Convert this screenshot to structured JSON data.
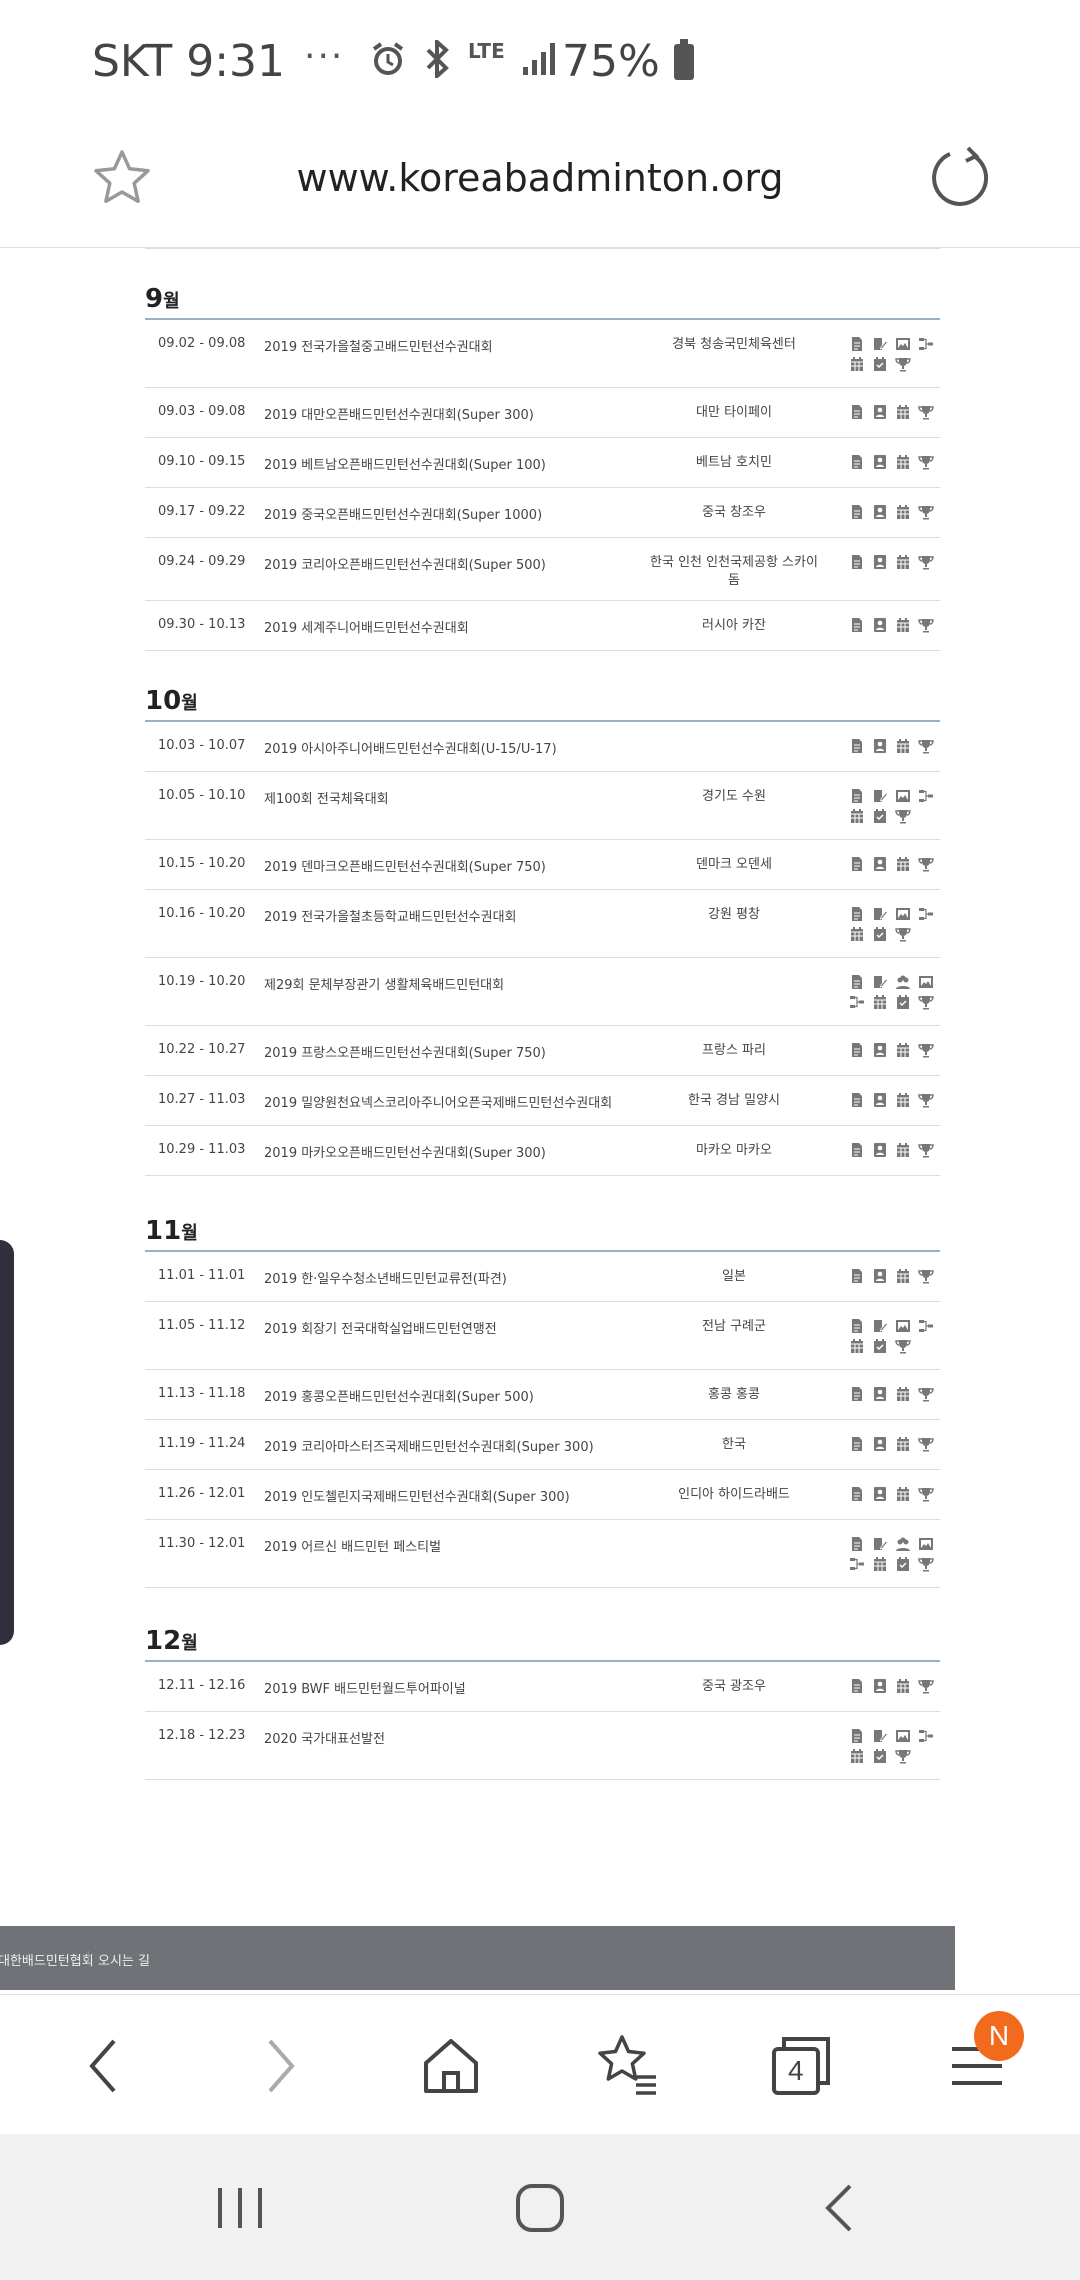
{
  "status_bar": {
    "carrier_time": "SKT 9:31",
    "dots": "···",
    "network": "LTE",
    "battery": "75%"
  },
  "url_bar": {
    "url": "www.koreabadminton.org"
  },
  "months": [
    {
      "label": "9",
      "suffix": "월",
      "rows": [
        {
          "date": "09.02 - 09.08",
          "name": "2019 전국가을철중고배드민턴선수권대회",
          "place": "경북 청송국민체육센터",
          "icons": [
            "doc",
            "edit",
            "photo",
            "bracket",
            "cal",
            "check",
            "trophy"
          ]
        },
        {
          "date": "09.03 - 09.08",
          "name": "2019 대만오픈배드민턴선수권대회(Super 300)",
          "place": "대만 타이페이",
          "icons": [
            "doc",
            "person",
            "cal",
            "trophy"
          ]
        },
        {
          "date": "09.10 - 09.15",
          "name": "2019 베트남오픈배드민턴선수권대회(Super 100)",
          "place": "베트남 호치민",
          "icons": [
            "doc",
            "person",
            "cal",
            "trophy"
          ]
        },
        {
          "date": "09.17 - 09.22",
          "name": "2019 중국오픈배드민턴선수권대회(Super 1000)",
          "place": "중국 창조우",
          "icons": [
            "doc",
            "person",
            "cal",
            "trophy"
          ]
        },
        {
          "date": "09.24 - 09.29",
          "name": "2019 코리아오픈배드민턴선수권대회(Super 500)",
          "place": "한국 인천 인천국제공항 스카이돔",
          "icons": [
            "doc",
            "person",
            "cal",
            "trophy"
          ]
        },
        {
          "date": "09.30 - 10.13",
          "name": "2019 세계주니어배드민턴선수권대회",
          "place": "러시아 카잔",
          "icons": [
            "doc",
            "person",
            "cal",
            "trophy"
          ]
        }
      ]
    },
    {
      "label": "10",
      "suffix": "월",
      "rows": [
        {
          "date": "10.03 - 10.07",
          "name": "2019 아시아주니어배드민턴선수권대회(U-15/U-17)",
          "place": "",
          "icons": [
            "doc",
            "person",
            "cal",
            "trophy"
          ]
        },
        {
          "date": "10.05 - 10.10",
          "name": "제100회 전국체육대회",
          "place": "경기도 수원",
          "icons": [
            "doc",
            "edit",
            "photo",
            "bracket",
            "cal",
            "check",
            "trophy"
          ]
        },
        {
          "date": "10.15 - 10.20",
          "name": "2019 덴마크오픈배드민턴선수권대회(Super 750)",
          "place": "덴마크 오덴세",
          "icons": [
            "doc",
            "person",
            "cal",
            "trophy"
          ]
        },
        {
          "date": "10.16 - 10.20",
          "name": "2019 전국가을철초등학교배드민턴선수권대회",
          "place": "강원 평창",
          "icons": [
            "doc",
            "edit",
            "photo",
            "bracket",
            "cal",
            "check",
            "trophy"
          ]
        },
        {
          "date": "10.19 - 10.20",
          "name": "제29회 문체부장관기 생활체육배드민턴대회",
          "place": "",
          "icons": [
            "doc",
            "edit",
            "group",
            "photo",
            "bracket",
            "cal",
            "check",
            "trophy"
          ]
        },
        {
          "date": "10.22 - 10.27",
          "name": "2019 프랑스오픈배드민턴선수권대회(Super 750)",
          "place": "프랑스 파리",
          "icons": [
            "doc",
            "person",
            "cal",
            "trophy"
          ]
        },
        {
          "date": "10.27 - 11.03",
          "name": "2019 밀양원천요넥스코리아주니어오픈국제배드민턴선수권대회",
          "place": "한국 경남 밀양시",
          "icons": [
            "doc",
            "person",
            "cal",
            "trophy"
          ]
        },
        {
          "date": "10.29 - 11.03",
          "name": "2019 마카오오픈배드민턴선수권대회(Super 300)",
          "place": "마카오 마카오",
          "icons": [
            "doc",
            "person",
            "cal",
            "trophy"
          ]
        }
      ]
    },
    {
      "label": "11",
      "suffix": "월",
      "rows": [
        {
          "date": "11.01 - 11.01",
          "name": "2019 한·일우수청소년배드민턴교류전(파견)",
          "place": "일본",
          "icons": [
            "doc",
            "person",
            "cal",
            "trophy"
          ]
        },
        {
          "date": "11.05 - 11.12",
          "name": "2019 회장기 전국대학실업배드민턴연맹전",
          "place": "전남 구례군",
          "icons": [
            "doc",
            "edit",
            "photo",
            "bracket",
            "cal",
            "check",
            "trophy"
          ]
        },
        {
          "date": "11.13 - 11.18",
          "name": "2019 홍콩오픈배드민턴선수권대회(Super 500)",
          "place": "홍콩 홍콩",
          "icons": [
            "doc",
            "person",
            "cal",
            "trophy"
          ]
        },
        {
          "date": "11.19 - 11.24",
          "name": "2019 코리아마스터즈국제배드민턴선수권대회(Super 300)",
          "place": "한국",
          "icons": [
            "doc",
            "person",
            "cal",
            "trophy"
          ]
        },
        {
          "date": "11.26 - 12.01",
          "name": "2019 인도첼린지국제배드민턴선수권대회(Super 300)",
          "place": "인디아 하이드라배드",
          "icons": [
            "doc",
            "person",
            "cal",
            "trophy"
          ]
        },
        {
          "date": "11.30 - 12.01",
          "name": "2019 어르신 배드민턴 페스티벌",
          "place": "",
          "icons": [
            "doc",
            "edit",
            "group",
            "photo",
            "bracket",
            "cal",
            "check",
            "trophy"
          ]
        }
      ]
    },
    {
      "label": "12",
      "suffix": "월",
      "rows": [
        {
          "date": "12.11 - 12.16",
          "name": "2019 BWF 배드민턴월드투어파이널",
          "place": "중국 광조우",
          "icons": [
            "doc",
            "person",
            "cal",
            "trophy"
          ]
        },
        {
          "date": "12.18 - 12.23",
          "name": "2020 국가대표선발전",
          "place": "",
          "icons": [
            "doc",
            "edit",
            "photo",
            "bracket",
            "cal",
            "check",
            "trophy"
          ]
        }
      ]
    }
  ],
  "footer": {
    "org": "대한배드민턴협회",
    "directions": "오시는 길"
  },
  "browser_bar": {
    "tabs_count": "4",
    "menu_badge": "N"
  }
}
